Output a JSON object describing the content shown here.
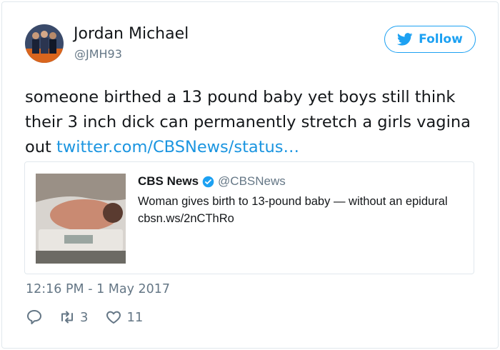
{
  "user": {
    "name": "Jordan Michael",
    "handle": "@JMH93",
    "follow_label": "Follow"
  },
  "tweet": {
    "text": "someone birthed a 13 pound baby yet boys still think their 3 inch dick can permanently stretch a girls vagina out",
    "link_text": "twitter.com/CBSNews/status…",
    "timestamp": "12:16 PM - 1 May 2017"
  },
  "quoted": {
    "name": "CBS News",
    "handle": "@CBSNews",
    "text": "Woman gives birth to 13-pound baby — without an epidural cbsn.ws/2nCThRo"
  },
  "actions": {
    "retweets": "3",
    "likes": "11"
  },
  "icons": {
    "avatar": "avatar-photo",
    "follow": "twitter-bird-icon",
    "verified": "verified-badge-icon",
    "reply": "reply-icon",
    "retweet": "retweet-icon",
    "like": "heart-icon"
  },
  "colors": {
    "accent": "#1da1f2",
    "link": "#1b95e0",
    "secondary_text": "#657786",
    "border": "#e1e8ed"
  }
}
